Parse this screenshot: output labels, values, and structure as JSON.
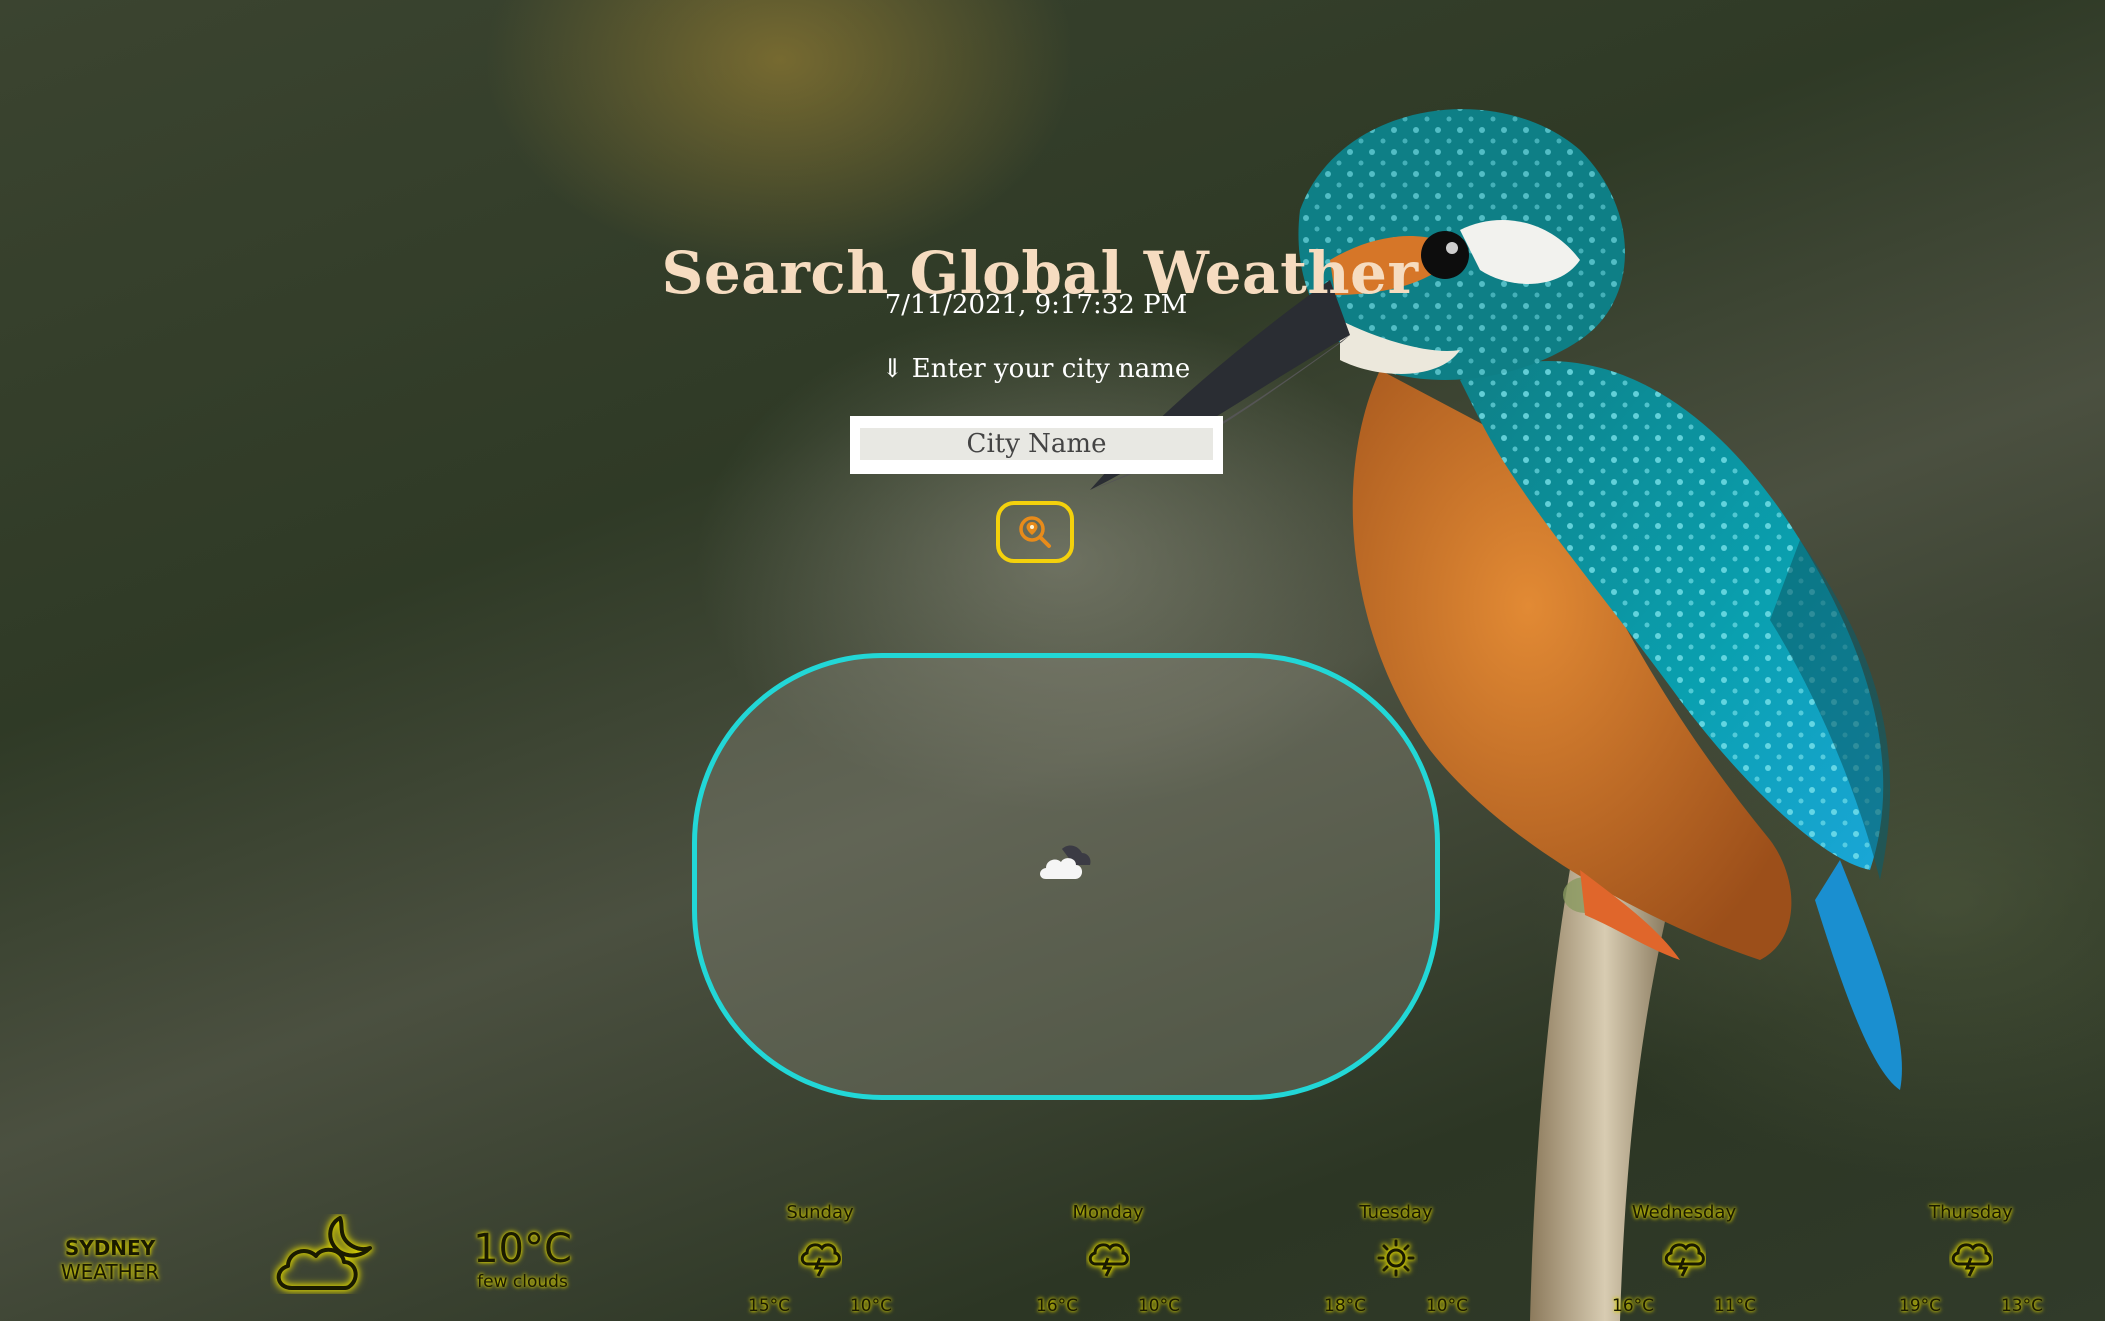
{
  "header": {
    "title": "Search Global Weather",
    "datetime": "7/11/2021, 9:17:32 PM",
    "prompt": "⇓ Enter your city name"
  },
  "search": {
    "placeholder": "City Name",
    "value": "",
    "button_icon": "location-search-icon"
  },
  "result": {
    "icon": "cloud-night-icon"
  },
  "background": {
    "image": "kingfisher-photo",
    "accent_card_border": "#22d7d7",
    "accent_button_border": "#f4d10c",
    "title_color": "#f6dcc0"
  },
  "widget": {
    "city": "SYDNEY",
    "label": "WEATHER",
    "current": {
      "icon": "partly-cloudy-night-icon",
      "temp": "10°C",
      "description": "few clouds"
    },
    "forecast": [
      {
        "day": "Sunday",
        "icon": "rain-cloud-icon",
        "high": "15°C",
        "low": "10°C"
      },
      {
        "day": "Monday",
        "icon": "rain-cloud-icon",
        "high": "16°C",
        "low": "10°C"
      },
      {
        "day": "Tuesday",
        "icon": "sun-icon",
        "high": "18°C",
        "low": "10°C"
      },
      {
        "day": "Wednesday",
        "icon": "rain-cloud-icon",
        "high": "16°C",
        "low": "11°C"
      },
      {
        "day": "Thursday",
        "icon": "rain-cloud-icon",
        "high": "19°C",
        "low": "13°C"
      }
    ]
  }
}
